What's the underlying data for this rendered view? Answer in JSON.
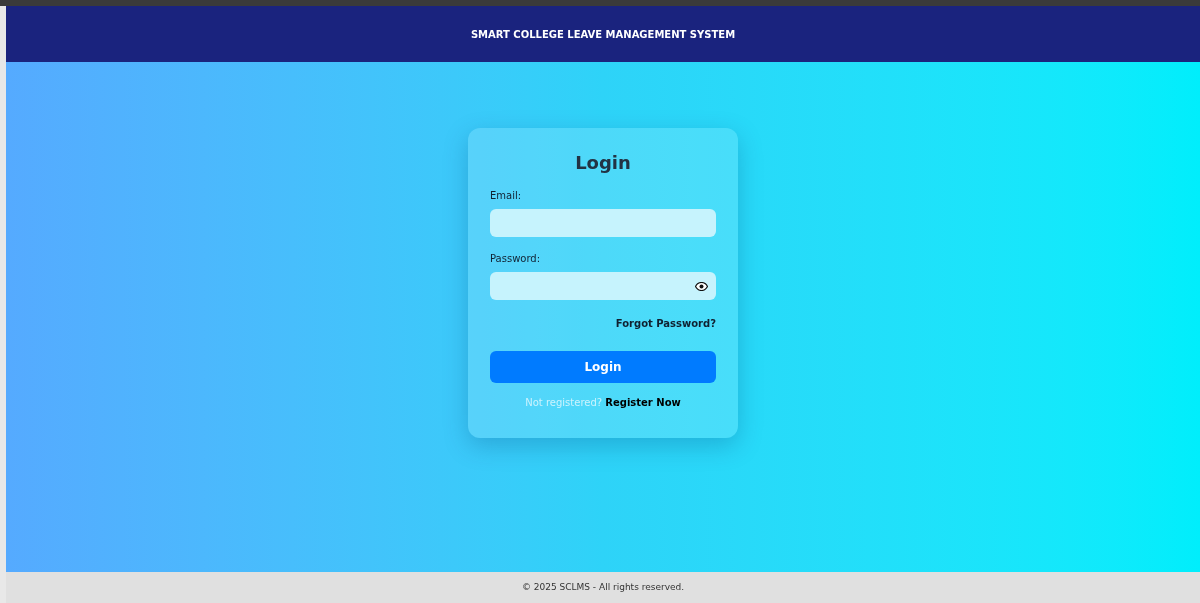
{
  "header": {
    "title": "SMART COLLEGE LEAVE MANAGEMENT SYSTEM"
  },
  "login_form": {
    "title": "Login",
    "fields": [
      {
        "label": "Email:",
        "kind": "text"
      },
      {
        "label": "Password:",
        "kind": "password"
      }
    ],
    "forgot_link": "Forgot Password?",
    "submit_button": "Login",
    "register_prompt": "Not registered?",
    "register_link": "Register Now"
  },
  "footer": {
    "text": "© 2025 SCLMS - All rights reserved."
  }
}
